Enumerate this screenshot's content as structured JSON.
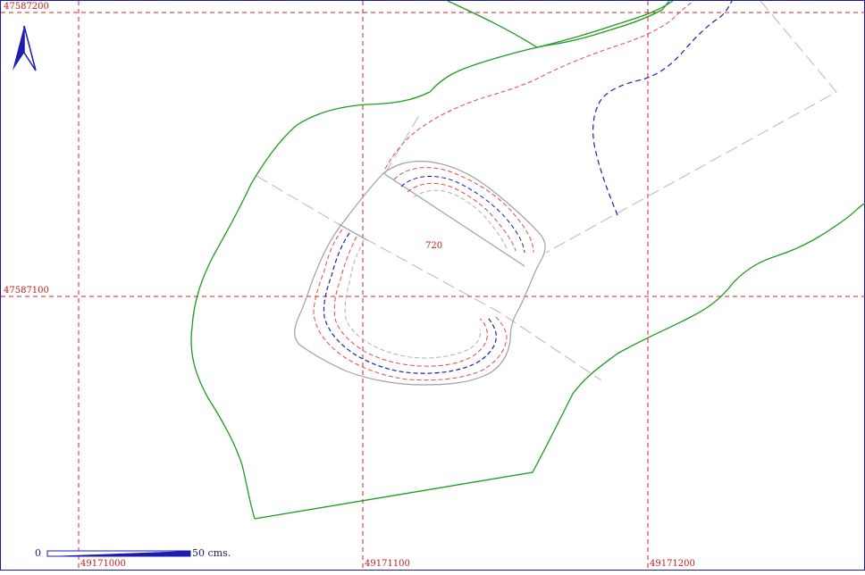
{
  "map": {
    "grid": {
      "x_labels": [
        "49171000",
        "49171100",
        "49171200"
      ],
      "y_labels": [
        "47587200",
        "47587100"
      ],
      "color": "#d42020"
    },
    "parcel_label": "720",
    "scale_bar": {
      "start_label": "0",
      "end_label": "50 cms."
    },
    "north_arrow_icon": "north-arrow-icon",
    "colors": {
      "boundary_green": "#1f9a1f",
      "contour_blue": "#1c1cb0",
      "contour_red": "#e04848",
      "outline_gray": "#a0a0a0"
    }
  }
}
